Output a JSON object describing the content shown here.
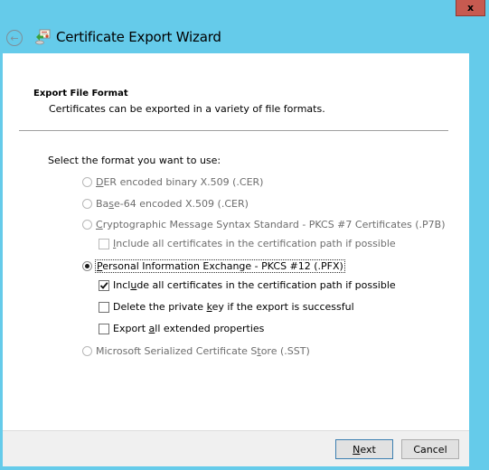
{
  "window": {
    "title": "Certificate Export Wizard",
    "close_glyph": "x",
    "back_glyph": "←",
    "accent_color": "#65cbea",
    "close_color": "#c75a50"
  },
  "page": {
    "heading": "Export File Format",
    "subheading": "Certificates can be exported in a variety of file formats.",
    "prompt": "Select the format you want to use:"
  },
  "options": [
    {
      "pre": "",
      "key": "D",
      "post": "ER encoded binary X.509 (.CER)",
      "checked": false,
      "enabled": false
    },
    {
      "pre": "Ba",
      "key": "s",
      "post": "e-64 encoded X.509 (.CER)",
      "checked": false,
      "enabled": false
    },
    {
      "pre": "",
      "key": "C",
      "post": "ryptographic Message Syntax Standard - PKCS #7 Certificates (.P7B)",
      "checked": false,
      "enabled": false
    },
    {
      "pre": "",
      "key": "P",
      "post": "ersonal Information Exchange - PKCS #12 (.PFX)",
      "checked": true,
      "enabled": true
    },
    {
      "pre": "Microsoft Serialized Certificate S",
      "key": "t",
      "post": "ore (.SST)",
      "checked": false,
      "enabled": false
    }
  ],
  "checkboxes": [
    {
      "pre": "",
      "key": "I",
      "post": "nclude all certificates in the certification path if possible",
      "checked": false,
      "enabled": false
    },
    {
      "pre": "Incl",
      "key": "u",
      "post": "de all certificates in the certification path if possible",
      "checked": true,
      "enabled": true
    },
    {
      "pre": "Delete the private ",
      "key": "k",
      "post": "ey if the export is successful",
      "checked": false,
      "enabled": true
    },
    {
      "pre": "Export ",
      "key": "a",
      "post": "ll extended properties",
      "checked": false,
      "enabled": true
    }
  ],
  "buttons": {
    "next": {
      "key": "N",
      "post": "ext"
    },
    "cancel": {
      "label": "Cancel"
    }
  }
}
